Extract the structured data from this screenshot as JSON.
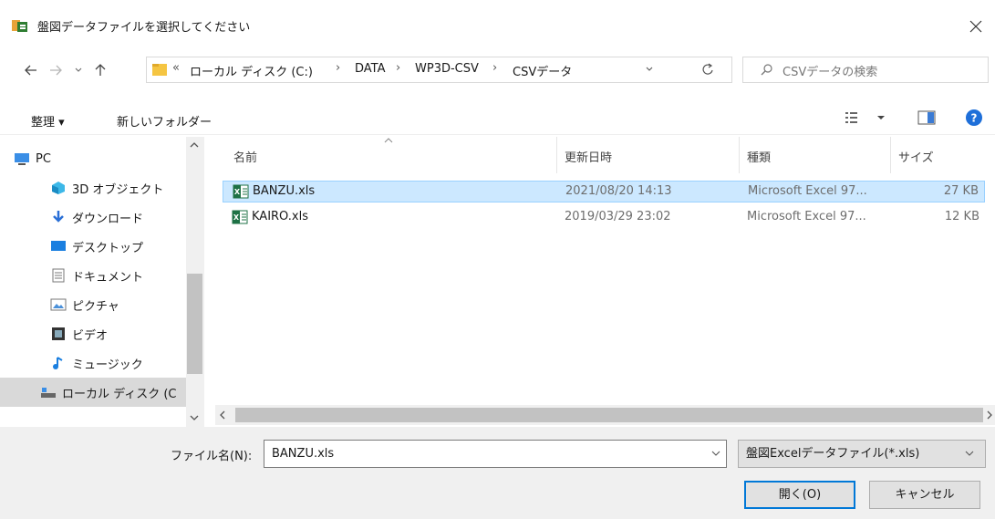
{
  "window": {
    "title": "盤図データファイルを選択してください"
  },
  "address": {
    "overflow": "«",
    "crumbs": [
      "ローカル ディスク (C:)",
      "DATA",
      "WP3D-CSV",
      "CSVデータ"
    ],
    "search_placeholder": "CSVデータの検索"
  },
  "toolbar": {
    "organize": "整理 ▾",
    "new_folder": "新しいフォルダー"
  },
  "nav": {
    "items": [
      {
        "label": "PC",
        "icon": "pc-icon"
      },
      {
        "label": "3D オブジェクト",
        "icon": "3d-objects-icon"
      },
      {
        "label": "ダウンロード",
        "icon": "download-icon"
      },
      {
        "label": "デスクトップ",
        "icon": "desktop-icon"
      },
      {
        "label": "ドキュメント",
        "icon": "document-icon"
      },
      {
        "label": "ピクチャ",
        "icon": "pictures-icon"
      },
      {
        "label": "ビデオ",
        "icon": "video-icon"
      },
      {
        "label": "ミュージック",
        "icon": "music-icon"
      },
      {
        "label": "ローカル ディスク (C",
        "icon": "drive-icon"
      }
    ]
  },
  "columns": {
    "name": "名前",
    "modified": "更新日時",
    "type": "種類",
    "size": "サイズ"
  },
  "files": [
    {
      "name": "BANZU.xls",
      "modified": "2021/08/20 14:13",
      "type": "Microsoft Excel 97...",
      "size": "27 KB",
      "selected": true
    },
    {
      "name": "KAIRO.xls",
      "modified": "2019/03/29 23:02",
      "type": "Microsoft Excel 97...",
      "size": "12 KB",
      "selected": false
    }
  ],
  "bottom": {
    "filename_label": "ファイル名(N):",
    "filename_value": "BANZU.xls",
    "filter": "盤図Excelデータファイル(*.xls)",
    "open": "開く(O)",
    "cancel": "キャンセル"
  },
  "colors": {
    "selection": "#cce8ff",
    "selection_border": "#99d1ff",
    "accent": "#0078d7",
    "help": "#1e6fd9",
    "excel": "#1e7145",
    "folder": "#f5c542"
  }
}
